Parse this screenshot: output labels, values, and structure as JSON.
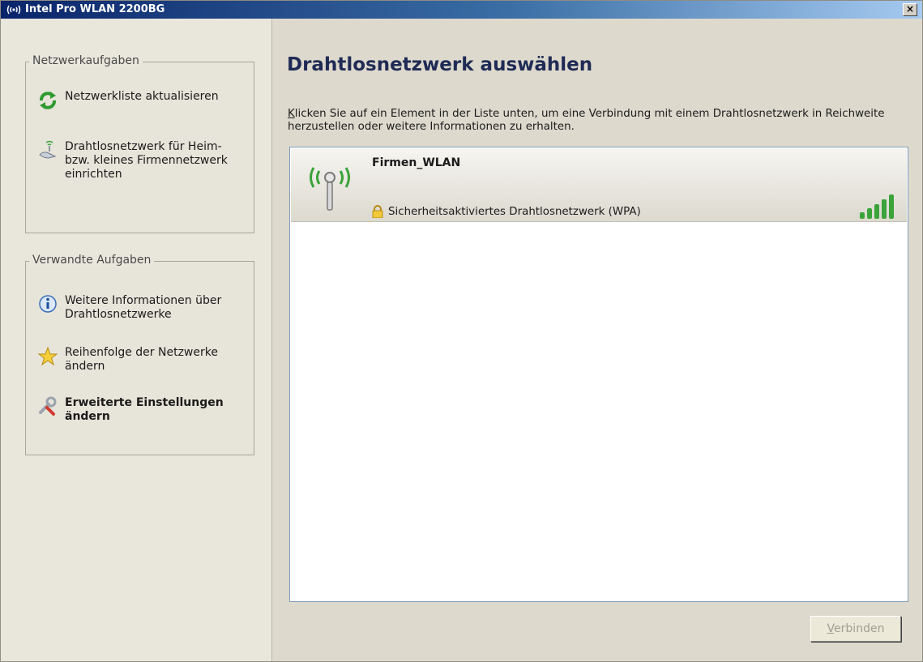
{
  "window": {
    "title": "Intel Pro WLAN 2200BG",
    "close_symbol": "×"
  },
  "sidebar": {
    "group1": {
      "title": "Netzwerkaufgaben",
      "items": [
        {
          "label": "Netzwerkliste aktualisieren",
          "icon": "refresh-icon"
        },
        {
          "label": "Drahtlosnetzwerk für Heim- bzw. kleines Firmennetzwerk einrichten",
          "icon": "network-setup-icon"
        }
      ]
    },
    "group2": {
      "title": "Verwandte Aufgaben",
      "items": [
        {
          "label": "Weitere Informationen über Drahtlosnetzwerke",
          "icon": "info-icon"
        },
        {
          "label": "Reihenfolge der Netzwerke ändern",
          "icon": "star-icon"
        },
        {
          "label": "Erweiterte Einstellungen ändern",
          "icon": "settings-icon"
        }
      ]
    }
  },
  "main": {
    "title": "Drahtlosnetzwerk auswählen",
    "description_first": "K",
    "description_rest": "licken Sie auf ein Element in der Liste unten, um eine Verbindung mit einem Drahtlosnetzwerk in Reichweite herzustellen oder weitere Informationen zu erhalten.",
    "networks": [
      {
        "name": "Firmen_WLAN",
        "security": "Sicherheitsaktiviertes Drahtlosnetzwerk (WPA)",
        "signal_bars": 5
      }
    ]
  },
  "footer": {
    "connect_accel": "V",
    "connect_rest": "erbinden"
  },
  "colors": {
    "title_accent": "#1f2b55",
    "signal_green": "#3aa33a"
  }
}
